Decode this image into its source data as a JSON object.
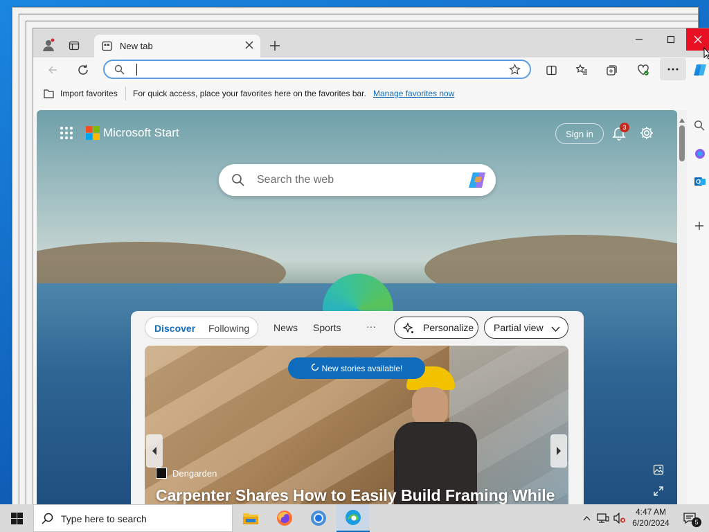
{
  "window": {
    "tab_title": "New tab",
    "address_value": "",
    "favorites_bar": {
      "import_label": "Import favorites",
      "hint_text": "For quick access, place your favorites here on the favorites bar.",
      "manage_link": "Manage favorites now"
    },
    "close_button_color": "#e81123"
  },
  "start_page": {
    "brand": "Microsoft Start",
    "sign_in": "Sign in",
    "notification_count": "3",
    "search_placeholder": "Search the web",
    "feed": {
      "tabs": [
        {
          "label": "Discover",
          "active": true
        },
        {
          "label": "Following",
          "active": false
        }
      ],
      "links": [
        "News",
        "Sports"
      ],
      "more": "···",
      "personalize": "Personalize",
      "view_select": "Partial view",
      "new_stories": "New stories available!",
      "article": {
        "source": "Dengarden",
        "headline": "Carpenter Shares How to Easily Build Framing While"
      }
    }
  },
  "taskbar": {
    "search_placeholder": "Type here to search",
    "time": "4:47 AM",
    "date": "6/20/2024",
    "notification_count": "5"
  },
  "colors": {
    "accent": "#0f6cbd",
    "new_stories_bg": "#0f6cbd",
    "badge": "#c42b1c"
  }
}
